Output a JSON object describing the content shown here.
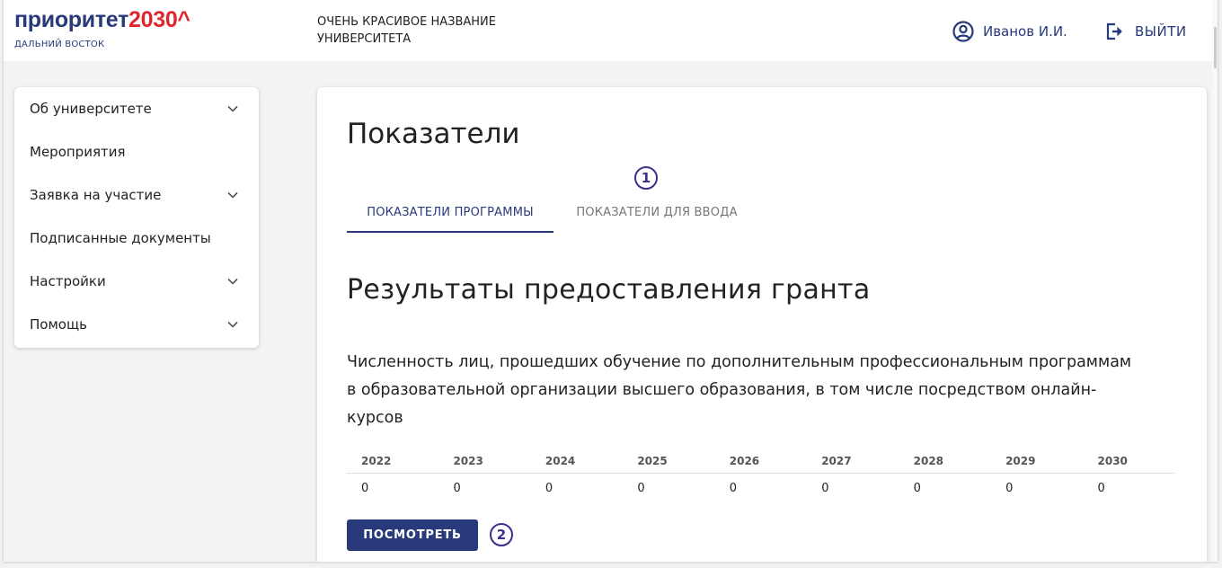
{
  "header": {
    "logo_text": "приоритет",
    "logo_year": "2030^",
    "logo_region": "ДАЛЬНИЙ ВОСТОК",
    "university_name": "ОЧЕНЬ КРАСИВОЕ НАЗВАНИЕ УНИВЕРСИТЕТА",
    "user_name": "Иванов И.И.",
    "logout_label": "ВЫЙТИ",
    "user_icon": "user-circle-icon",
    "logout_icon": "logout-icon"
  },
  "sidebar": {
    "items": [
      {
        "label": "Об университете",
        "has_submenu": true
      },
      {
        "label": "Мероприятия",
        "has_submenu": false
      },
      {
        "label": "Заявка на участие",
        "has_submenu": true
      },
      {
        "label": "Подписанные документы",
        "has_submenu": false
      },
      {
        "label": "Настройки",
        "has_submenu": true
      },
      {
        "label": "Помощь",
        "has_submenu": true
      }
    ]
  },
  "main": {
    "page_title": "Показатели",
    "tabs": [
      {
        "label": "ПОКАЗАТЕЛИ ПРОГРАММЫ",
        "active": true
      },
      {
        "label": "ПОКАЗАТЕЛИ ДЛЯ ВВОДА",
        "active": false
      }
    ],
    "markers": [
      "1",
      "2"
    ],
    "section_title": "Результаты предоставления гранта",
    "indicator_text": "Численность лиц, прошедших обучение по дополнительным профессиональным программам в образовательной организации высшего образования, в том числе посредством онлайн-курсов",
    "table": {
      "years": [
        "2022",
        "2023",
        "2024",
        "2025",
        "2026",
        "2027",
        "2028",
        "2029",
        "2030"
      ],
      "values": [
        "0",
        "0",
        "0",
        "0",
        "0",
        "0",
        "0",
        "0",
        "0"
      ]
    },
    "view_button_label": "ПОСМОТРЕТЬ"
  },
  "colors": {
    "brand_blue": "#283a7a",
    "brand_red": "#e0262d",
    "marker_purple": "#3b2f8c",
    "background": "#f3f3f4"
  }
}
